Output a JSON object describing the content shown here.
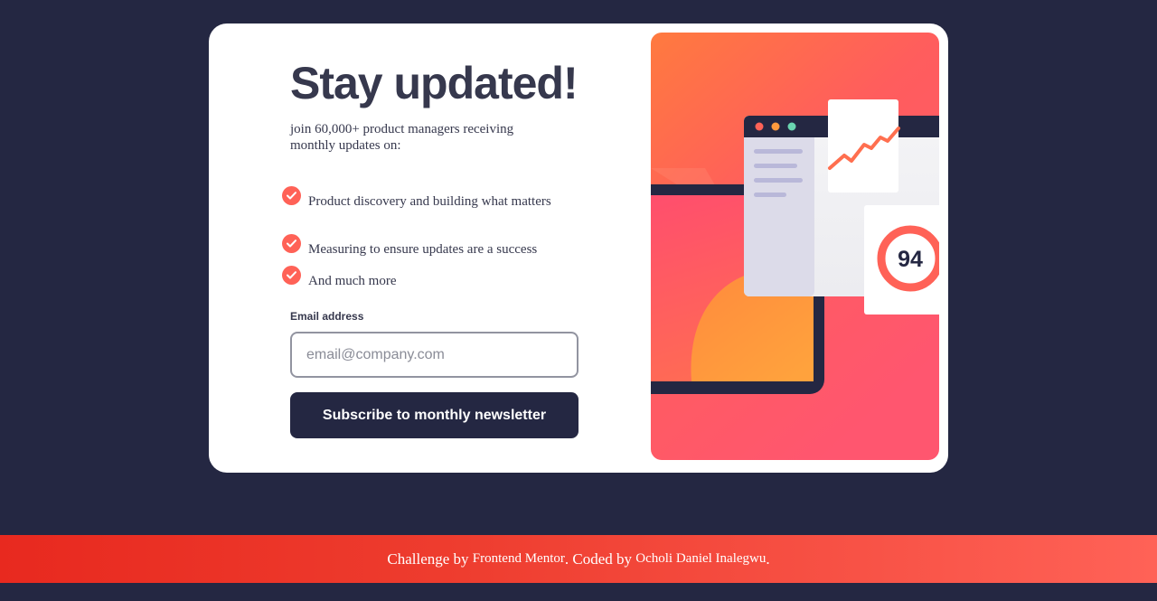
{
  "signup": {
    "title": "Stay updated!",
    "intro": "join 60,000+ product managers receiving monthly updates on:",
    "features": [
      "Product discovery and building what matters",
      "Measuring to ensure updates are a success",
      "And much more"
    ],
    "email_label": "Email address",
    "email_placeholder": "email@company.com",
    "email_value": "",
    "subscribe_label": "Subscribe to monthly newsletter"
  },
  "illustration": {
    "score": "94"
  },
  "footer": {
    "challenge_text": "Challenge by",
    "challenge_link": "Frontend Mentor",
    "coded_text": ". Coded by",
    "author_link": "Ocholi Daniel Inalegwu",
    "end": "."
  },
  "colors": {
    "page_background": "#242742",
    "accent": "#ff6257",
    "button": "#242742",
    "text": "#36384d"
  },
  "icons": {
    "feature_bullet": "check-icon"
  }
}
